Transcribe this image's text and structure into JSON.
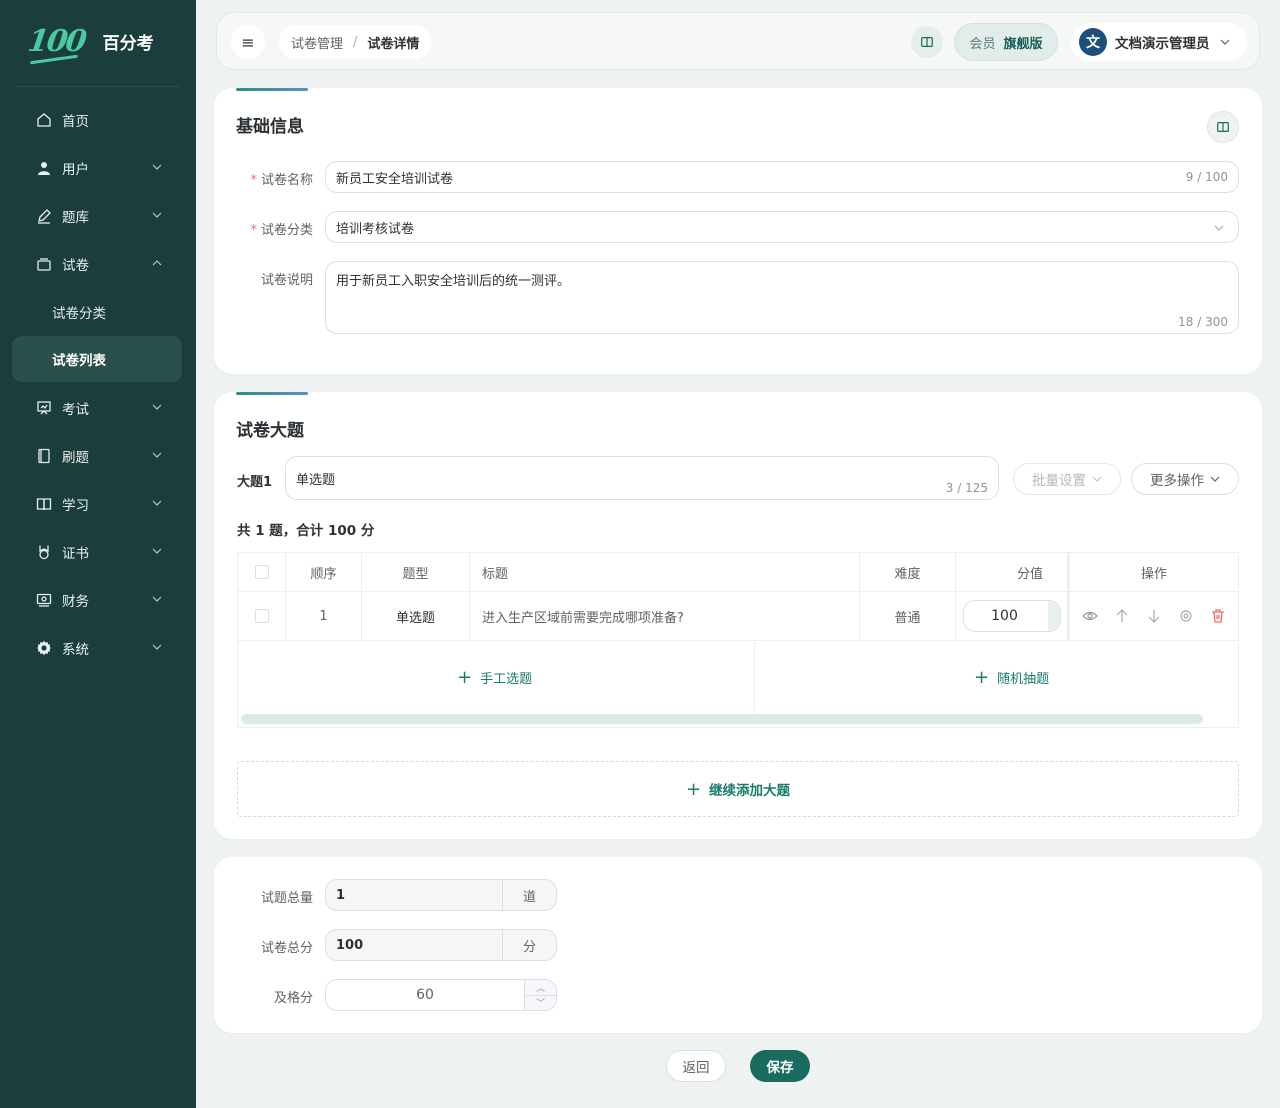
{
  "brand": {
    "logo_text": "100",
    "name": "百分考"
  },
  "sidebar": {
    "items": [
      {
        "label": "首页",
        "icon": "home-icon"
      },
      {
        "label": "用户",
        "icon": "user-icon"
      },
      {
        "label": "题库",
        "icon": "pen-icon"
      },
      {
        "label": "试卷",
        "icon": "paper-icon"
      },
      {
        "label": "考试",
        "icon": "presentation-icon"
      },
      {
        "label": "刷题",
        "icon": "notebook-icon"
      },
      {
        "label": "学习",
        "icon": "book-icon"
      },
      {
        "label": "证书",
        "icon": "medal-icon"
      },
      {
        "label": "财务",
        "icon": "wallet-icon"
      },
      {
        "label": "系统",
        "icon": "gear-icon"
      }
    ],
    "sub_items": [
      {
        "label": "试卷分类"
      },
      {
        "label": "试卷列表"
      }
    ]
  },
  "topbar": {
    "breadcrumb": [
      "试卷管理",
      "试卷详情"
    ],
    "breadcrumb_sep": "/",
    "vip_label": "会员",
    "vip_tier": "旗舰版",
    "user_avatar": "文",
    "user_name": "文档演示管理员"
  },
  "basic": {
    "title": "基础信息",
    "name_label": "试卷名称",
    "name_value": "新员工安全培训试卷",
    "name_count": "9 / 100",
    "category_label": "试卷分类",
    "category_value": "培训考核试卷",
    "desc_label": "试卷说明",
    "desc_value": "用于新员工入职安全培训后的统一测评。",
    "desc_count": "18 / 300"
  },
  "sections": {
    "title": "试卷大题",
    "section_label": "大题1",
    "section_name": "单选题",
    "section_count": "3 / 125",
    "batch_btn": "批量设置",
    "more_btn": "更多操作",
    "summary": "共 1 题，合计 100 分",
    "table": {
      "headers": [
        "顺序",
        "题型",
        "标题",
        "难度",
        "分值",
        "操作"
      ],
      "rows": [
        {
          "order": "1",
          "type": "单选题",
          "title": "进入生产区域前需要完成哪项准备?",
          "difficulty": "普通",
          "score": "100"
        }
      ]
    },
    "manual_pick": "手工选题",
    "random_pick": "随机抽题",
    "add_section": "继续添加大题"
  },
  "totals": {
    "count_label": "试题总量",
    "count_value": "1",
    "count_unit": "道",
    "score_label": "试卷总分",
    "score_value": "100",
    "score_unit": "分",
    "pass_label": "及格分",
    "pass_value": "60"
  },
  "footer": {
    "back": "返回",
    "save": "保存"
  },
  "colors": {
    "sidebar": "#1b3d3b",
    "primary": "#1a6b5f",
    "accent": "#4cc9a3",
    "danger": "#f56c6c"
  }
}
